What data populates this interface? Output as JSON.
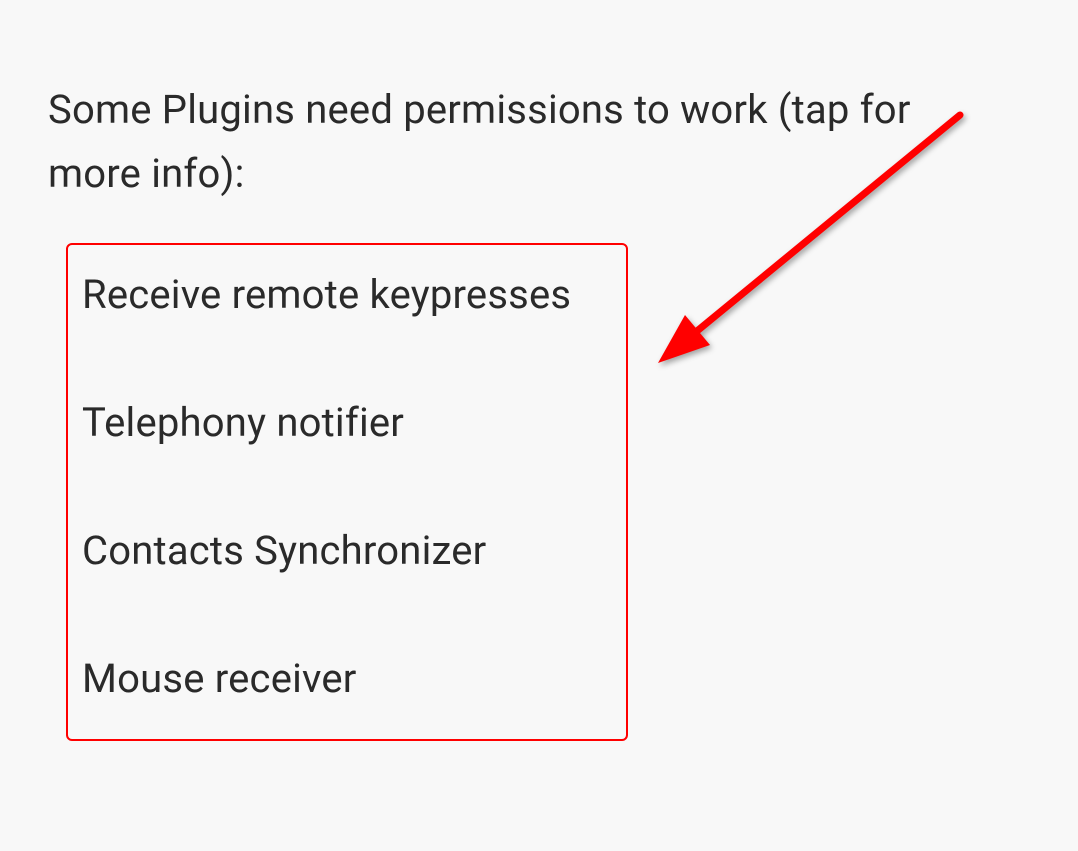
{
  "header": {
    "text": "Some Plugins need permissions to work (tap for more info):"
  },
  "plugins": {
    "items": [
      {
        "label": "Receive remote keypresses"
      },
      {
        "label": "Telephony notifier"
      },
      {
        "label": "Contacts Synchronizer"
      },
      {
        "label": "Mouse receiver"
      }
    ]
  },
  "colors": {
    "highlight_border": "#ff0000",
    "arrow": "#ff0000",
    "text": "#2a2a2a",
    "background": "#f8f8f8"
  }
}
